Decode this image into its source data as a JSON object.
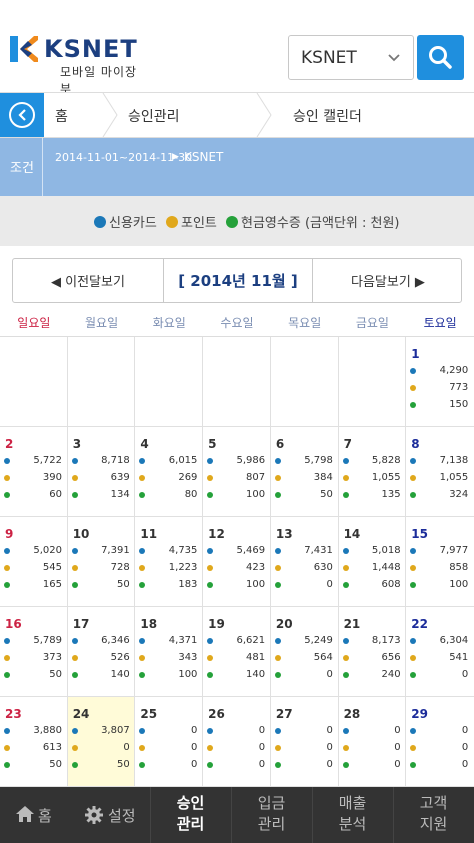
{
  "header": {
    "logo_text": "KSNET",
    "logo_subtitle": "모바일 마이장부",
    "store_select": {
      "value": "KSNET"
    }
  },
  "breadcrumb": {
    "items": [
      "홈",
      "승인관리",
      "승인 캘린더"
    ]
  },
  "filter": {
    "label": "조건",
    "range": "2014-11-01~2014-11-30",
    "merchant": "KSNET"
  },
  "legend": {
    "items": [
      {
        "label": "신용카드",
        "color": "#1b78b8"
      },
      {
        "label": "포인트",
        "color": "#e0a81c"
      },
      {
        "label": "현금영수증 (금액단위 : 천원)",
        "color": "#25a13a"
      }
    ]
  },
  "month_nav": {
    "prev_label": "◀ 이전달보기",
    "title": "[ 2014년 11월 ]",
    "next_label": "다음달보기 ▶"
  },
  "calendar": {
    "weekdays": [
      {
        "label": "일요일",
        "color": "#cc2244"
      },
      {
        "label": "월요일",
        "color": "#7a8db2"
      },
      {
        "label": "화요일",
        "color": "#7a8db2"
      },
      {
        "label": "수요일",
        "color": "#7a8db2"
      },
      {
        "label": "목요일",
        "color": "#7a8db2"
      },
      {
        "label": "금요일",
        "color": "#7a8db2"
      },
      {
        "label": "토요일",
        "color": "#1c2c9a"
      }
    ],
    "cells": [
      {
        "col": 6,
        "week": 0,
        "day": "1",
        "card": "4,290",
        "point": "773",
        "cash": "150"
      },
      {
        "col": 0,
        "week": 1,
        "day": "2",
        "card": "5,722",
        "point": "390",
        "cash": "60"
      },
      {
        "col": 1,
        "week": 1,
        "day": "3",
        "card": "8,718",
        "point": "639",
        "cash": "134"
      },
      {
        "col": 2,
        "week": 1,
        "day": "4",
        "card": "6,015",
        "point": "269",
        "cash": "80"
      },
      {
        "col": 3,
        "week": 1,
        "day": "5",
        "card": "5,986",
        "point": "807",
        "cash": "100"
      },
      {
        "col": 4,
        "week": 1,
        "day": "6",
        "card": "5,798",
        "point": "384",
        "cash": "50"
      },
      {
        "col": 5,
        "week": 1,
        "day": "7",
        "card": "5,828",
        "point": "1,055",
        "cash": "135"
      },
      {
        "col": 6,
        "week": 1,
        "day": "8",
        "card": "7,138",
        "point": "1,055",
        "cash": "324"
      },
      {
        "col": 0,
        "week": 2,
        "day": "9",
        "card": "5,020",
        "point": "545",
        "cash": "165"
      },
      {
        "col": 1,
        "week": 2,
        "day": "10",
        "card": "7,391",
        "point": "728",
        "cash": "50"
      },
      {
        "col": 2,
        "week": 2,
        "day": "11",
        "card": "4,735",
        "point": "1,223",
        "cash": "183"
      },
      {
        "col": 3,
        "week": 2,
        "day": "12",
        "card": "5,469",
        "point": "423",
        "cash": "100"
      },
      {
        "col": 4,
        "week": 2,
        "day": "13",
        "card": "7,431",
        "point": "630",
        "cash": "0"
      },
      {
        "col": 5,
        "week": 2,
        "day": "14",
        "card": "5,018",
        "point": "1,448",
        "cash": "608"
      },
      {
        "col": 6,
        "week": 2,
        "day": "15",
        "card": "7,977",
        "point": "858",
        "cash": "100"
      },
      {
        "col": 0,
        "week": 3,
        "day": "16",
        "card": "5,789",
        "point": "373",
        "cash": "50"
      },
      {
        "col": 1,
        "week": 3,
        "day": "17",
        "card": "6,346",
        "point": "526",
        "cash": "140"
      },
      {
        "col": 2,
        "week": 3,
        "day": "18",
        "card": "4,371",
        "point": "343",
        "cash": "100"
      },
      {
        "col": 3,
        "week": 3,
        "day": "19",
        "card": "6,621",
        "point": "481",
        "cash": "140"
      },
      {
        "col": 4,
        "week": 3,
        "day": "20",
        "card": "5,249",
        "point": "564",
        "cash": "0"
      },
      {
        "col": 5,
        "week": 3,
        "day": "21",
        "card": "8,173",
        "point": "656",
        "cash": "240"
      },
      {
        "col": 6,
        "week": 3,
        "day": "22",
        "card": "6,304",
        "point": "541",
        "cash": "0"
      },
      {
        "col": 0,
        "week": 4,
        "day": "23",
        "card": "3,880",
        "point": "613",
        "cash": "50"
      },
      {
        "col": 1,
        "week": 4,
        "day": "24",
        "card": "3,807",
        "point": "0",
        "cash": "50",
        "today": true
      },
      {
        "col": 2,
        "week": 4,
        "day": "25",
        "card": "0",
        "point": "0",
        "cash": "0"
      },
      {
        "col": 3,
        "week": 4,
        "day": "26",
        "card": "0",
        "point": "0",
        "cash": "0"
      },
      {
        "col": 4,
        "week": 4,
        "day": "27",
        "card": "0",
        "point": "0",
        "cash": "0"
      },
      {
        "col": 5,
        "week": 4,
        "day": "28",
        "card": "0",
        "point": "0",
        "cash": "0"
      },
      {
        "col": 6,
        "week": 4,
        "day": "29",
        "card": "0",
        "point": "0",
        "cash": "0"
      }
    ]
  },
  "bottom_nav": {
    "home": "홈",
    "settings": "설정",
    "items": [
      {
        "line1": "승인",
        "line2": "관리",
        "active": true
      },
      {
        "line1": "입금",
        "line2": "관리",
        "active": false
      },
      {
        "line1": "매출",
        "line2": "분석",
        "active": false
      },
      {
        "line1": "고객",
        "line2": "지원",
        "active": false
      }
    ]
  }
}
